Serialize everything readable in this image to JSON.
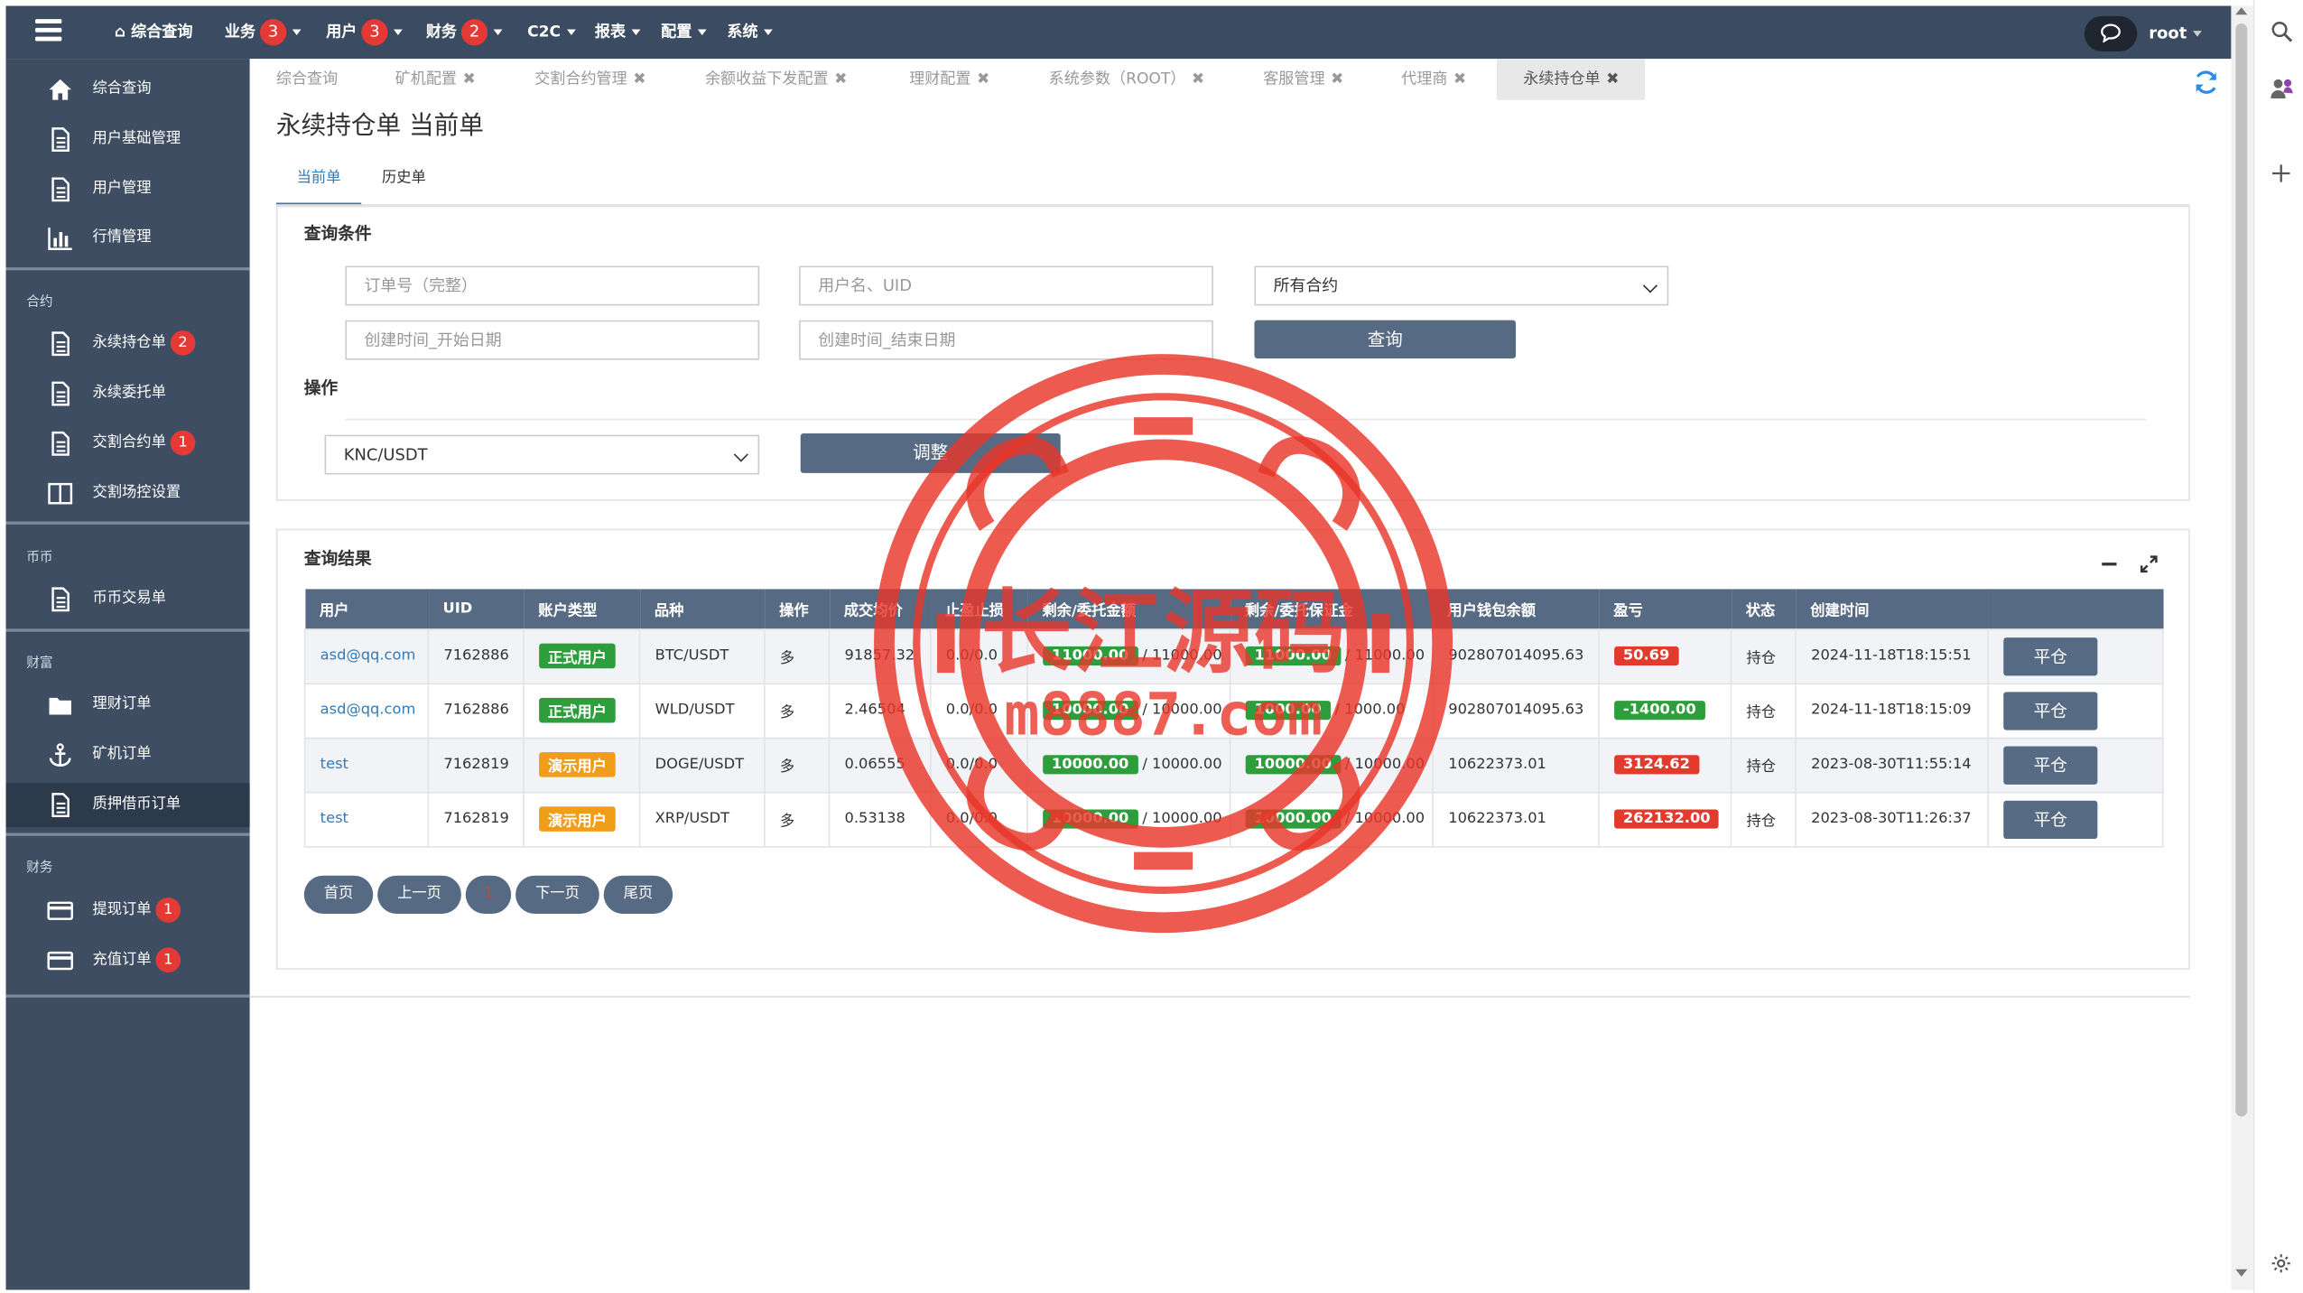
{
  "topnav": {
    "items": [
      {
        "label": "综合查询",
        "badge": ""
      },
      {
        "label": "业务",
        "badge": "3"
      },
      {
        "label": "用户",
        "badge": "3"
      },
      {
        "label": "财务",
        "badge": "2"
      },
      {
        "label": "C2C",
        "badge": ""
      },
      {
        "label": "报表",
        "badge": ""
      },
      {
        "label": "配置",
        "badge": ""
      },
      {
        "label": "系统",
        "badge": ""
      }
    ],
    "user": "root"
  },
  "sidebar": {
    "items_top": [
      {
        "label": "综合查询",
        "icon": "home-icon"
      },
      {
        "label": "用户基础管理",
        "icon": "document-icon"
      },
      {
        "label": "用户管理",
        "icon": "document-icon"
      },
      {
        "label": "行情管理",
        "icon": "bar-chart-icon"
      }
    ],
    "section_contract": "合约",
    "items_contract": [
      {
        "label": "永续持仓单",
        "badge": "2"
      },
      {
        "label": "永续委托单",
        "badge": ""
      },
      {
        "label": "交割合约单",
        "badge": "1"
      },
      {
        "label": "交割场控设置",
        "badge": ""
      }
    ],
    "section_coin": "币币",
    "items_coin": [
      {
        "label": "币币交易单"
      }
    ],
    "section_wealth": "财富",
    "items_wealth": [
      {
        "label": "理财订单"
      },
      {
        "label": "矿机订单"
      },
      {
        "label": "质押借币订单"
      }
    ],
    "section_finance": "财务",
    "items_finance": [
      {
        "label": "提现订单",
        "badge": "1"
      },
      {
        "label": "充值订单",
        "badge": "1"
      }
    ]
  },
  "tabs": [
    {
      "label": "综合查询",
      "closable": false
    },
    {
      "label": "矿机配置",
      "closable": true
    },
    {
      "label": "交割合约管理",
      "closable": true
    },
    {
      "label": "余额收益下发配置",
      "closable": true
    },
    {
      "label": "理财配置",
      "closable": true
    },
    {
      "label": "系统参数（ROOT）",
      "closable": true
    },
    {
      "label": "客服管理",
      "closable": true
    },
    {
      "label": "代理商",
      "closable": true
    },
    {
      "label": "永续持仓单",
      "closable": true
    }
  ],
  "page": {
    "title": "永续持仓单 当前单",
    "subtab_current": "当前单",
    "subtab_history": "历史单"
  },
  "query": {
    "title": "查询条件",
    "order_no_placeholder": "订单号（完整）",
    "user_placeholder": "用户名、UID",
    "contract_selected": "所有合约",
    "start_placeholder": "创建时间_开始日期",
    "end_placeholder": "创建时间_结束日期",
    "search_label": "查询",
    "op_title": "操作",
    "pair_selected": "KNC/USDT",
    "adjust_label": "调整"
  },
  "results": {
    "title": "查询结果",
    "columns": [
      "用户",
      "UID",
      "账户类型",
      "品种",
      "操作",
      "成交均价",
      "止盈止损",
      "剩余/委托金额",
      "剩余/委托保证金",
      "用户钱包余额",
      "盈亏",
      "状态",
      "创建时间",
      ""
    ],
    "rows": [
      {
        "user": "asd@qq.com",
        "uid": "7162886",
        "type": "正式用户",
        "symbol": "BTC/USDT",
        "op": "多",
        "price": "91857.32",
        "tpsl": "0.0/0.0",
        "remain_amt": "11000.00",
        "amt_total": "/ 11000.00",
        "remain_margin": "11000.00",
        "margin_total": "/ 11000.00",
        "wallet": "902807014095.63",
        "pnl": "50.69",
        "status": "持仓",
        "time": "2024-11-18T18:15:51",
        "action": "平仓"
      },
      {
        "user": "asd@qq.com",
        "uid": "7162886",
        "type": "正式用户",
        "symbol": "WLD/USDT",
        "op": "多",
        "price": "2.46504",
        "tpsl": "0.0/0.0",
        "remain_amt": "10000.00",
        "amt_total": "/ 10000.00",
        "remain_margin": "1000.00",
        "margin_total": "/ 1000.00",
        "wallet": "902807014095.63",
        "pnl": "-1400.00",
        "status": "持仓",
        "time": "2024-11-18T18:15:09",
        "action": "平仓"
      },
      {
        "user": "test",
        "uid": "7162819",
        "type": "演示用户",
        "symbol": "DOGE/USDT",
        "op": "多",
        "price": "0.06555",
        "tpsl": "0.0/0.0",
        "remain_amt": "10000.00",
        "amt_total": "/ 10000.00",
        "remain_margin": "10000.00",
        "margin_total": "/ 10000.00",
        "wallet": "10622373.01",
        "pnl": "3124.62",
        "status": "持仓",
        "time": "2023-08-30T11:55:14",
        "action": "平仓"
      },
      {
        "user": "test",
        "uid": "7162819",
        "type": "演示用户",
        "symbol": "XRP/USDT",
        "op": "多",
        "price": "0.53138",
        "tpsl": "0.0/0.0",
        "remain_amt": "10000.00",
        "amt_total": "/ 10000.00",
        "remain_margin": "10000.00",
        "margin_total": "/ 10000.00",
        "wallet": "10622373.01",
        "pnl": "262132.00",
        "status": "持仓",
        "time": "2023-08-30T11:26:37",
        "action": "平仓"
      }
    ]
  },
  "pager": {
    "first": "首页",
    "prev": "上一页",
    "current": "1",
    "next": "下一页",
    "last": "尾页"
  },
  "watermark": {
    "line1": "长江源码",
    "line2": "m8887.com"
  },
  "colors": {
    "nav": "#3b4b61",
    "sidebar": "#3e4d62",
    "button": "#566a84",
    "link": "#337ab7",
    "green": "#2e9e3c",
    "orange": "#f09d19",
    "red": "#e23b2d"
  }
}
